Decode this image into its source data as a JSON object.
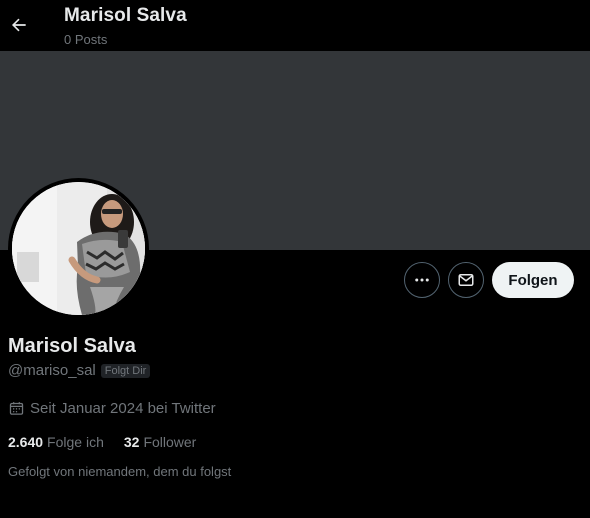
{
  "header": {
    "title": "Marisol Salva",
    "posts_count": "0 Posts"
  },
  "profile": {
    "display_name": "Marisol Salva",
    "handle": "@mariso_sal",
    "follows_you_badge": "Folgt Dir",
    "joined": "Seit Januar 2024 bei Twitter",
    "following_count": "2.640",
    "following_label": "Folge ich",
    "followers_count": "32",
    "followers_label": "Follower",
    "followed_by_text": "Gefolgt von niemandem, dem du folgst"
  },
  "actions": {
    "follow_label": "Folgen",
    "more_icon": "more-horizontal-icon",
    "message_icon": "mail-icon"
  },
  "colors": {
    "background": "#000000",
    "banner": "#333639",
    "primary_text": "#e7e9ea",
    "secondary_text": "#71767b",
    "follow_button_bg": "#eff3f4",
    "border": "#536471"
  }
}
